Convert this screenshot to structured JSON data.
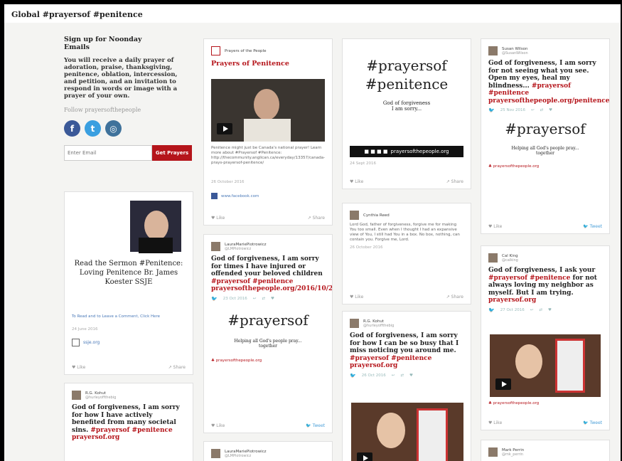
{
  "site": {
    "title": "Global #prayersof #penitence"
  },
  "sidebar": {
    "signup_heading": "Sign up for Noonday Emails",
    "signup_desc": "You will receive a daily prayer of adoration, praise, thanksgiving, penitence, oblation, intercession, and petition, and an invitation to respond in words or image with a prayer of your own.",
    "follow": "Follow prayersofthepeople",
    "socials": [
      "facebook-icon",
      "twitter-icon",
      "instagram-icon"
    ],
    "email_placeholder": "Enter Email",
    "email_button": "Get Prayers"
  },
  "colors": {
    "accent": "#b5151b",
    "facebook": "#3b5998",
    "twitter": "#3a9fe0",
    "instagram": "#3f729b"
  },
  "cards": {
    "sermon": {
      "text": "Read the Sermon #Penitence: Loving Penitence Br. James Koester SSJE",
      "link": "To Read and to Leave a Comment, Click Here",
      "date": "24 June 2016",
      "domain": "ssje.org",
      "like": "Like",
      "share": "Share"
    },
    "rg1": {
      "name": "R.G. Kohut",
      "handle": "@hurleyoffthebig",
      "text": "God of forgiveness, I am sorry for how I have actively benefited from many societal sins.",
      "tags": "#prayersof #penitence prayersof.org"
    },
    "potp": {
      "name": "Prayers of the People",
      "title": "Prayers of Penitence",
      "desc": "Penitence might just be Canada's national prayer! Learn more about #Prayersof #Penitence: http://thecommunity.anglican.ca/everyday/13357/canada-prays-prayersof-penitence/",
      "date": "26 October 2016",
      "link": "www.facebook.com",
      "like": "Like",
      "share": "Share"
    },
    "laura1": {
      "name": "LauraMariePiotrowicz",
      "handle": "@LMPiotrowicz",
      "text": "God of forgiveness, I am sorry for times I have injured or offended your beloved children",
      "tags": "#prayersof #penitence prayersofthepeople.org/2016/10/23/pen...",
      "date": "23 Oct 2016",
      "big": "#prayersof",
      "sub": "Helping all God's people pray... together",
      "link": "prayersofthepeople.org",
      "like": "Like",
      "tweet": "Tweet"
    },
    "laura2": {
      "name": "LauraMariePiotrowicz",
      "handle": "@LMPiotrowicz"
    },
    "graphic": {
      "line1": "#prayersof",
      "line2": "#penitence",
      "small1": "God of forgiveness",
      "small2": "I am sorry...",
      "bar": "prayersofthepeople.org",
      "date": "24 Sept 2016",
      "like": "Like",
      "share": "Share"
    },
    "cynthia": {
      "name": "Cynthia Reed",
      "text": "Lord God, father of forgiveness, forgive me for making You too small. Even when I thought I had an expansive view of You, I still had You in a box. No box, nothing, can contain you. Forgive me, Lord.",
      "date": "26 October 2016",
      "like": "Like",
      "share": "Share"
    },
    "rg2": {
      "name": "R.G. Kohut",
      "handle": "@hurleyoffthebig",
      "text": "God of forgiveness, I am sorry for how I can be so busy that I miss noticing you around me.",
      "tags": "#prayersof #penitence prayersof.org",
      "date": "26 Oct 2016"
    },
    "susan": {
      "name": "Susan Wilson",
      "handle": "@SusanWilson",
      "text": "God of forgiveness, I am sorry for not seeing what you see. Open my eyes, heal my blindness...",
      "tags": "#prayersof #penitence prayersofthepeople.org/penitence/",
      "date": "25 Nov 2016",
      "big": "#prayersof",
      "sub": "Helping all God's people pray... together",
      "link": "prayersofthepeople.org",
      "like": "Like",
      "tweet": "Tweet"
    },
    "cal": {
      "name": "Cal King",
      "handle": "@calking",
      "text": "God of forgiveness, I ask your",
      "tags1": "#prayersof #penitence",
      "text2": "for not always loving my neighbor as myself. But I am trying.",
      "tags2": "prayersof.org",
      "date": "27 Oct 2016",
      "link": "prayersofthepeople.org",
      "like": "Like",
      "tweet": "Tweet"
    },
    "mark": {
      "name": "Mark Perrin",
      "handle": "@mk_perrin"
    }
  }
}
